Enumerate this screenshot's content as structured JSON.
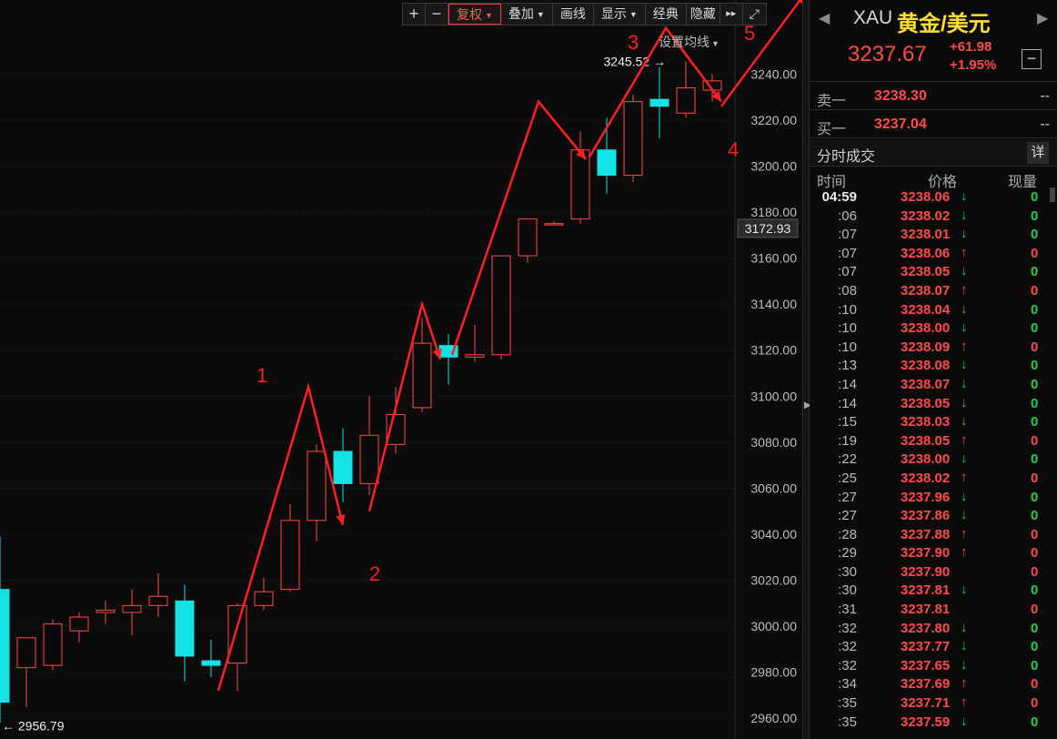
{
  "toolbar": {
    "zoom_in": "+",
    "zoom_out": "−",
    "items": [
      {
        "label": "复权",
        "dropdown": true,
        "active": true
      },
      {
        "label": "叠加",
        "dropdown": true,
        "active": false
      },
      {
        "label": "画线",
        "dropdown": false,
        "active": false
      },
      {
        "label": "显示",
        "dropdown": true,
        "active": false
      },
      {
        "label": "经典",
        "dropdown": false,
        "active": false
      },
      {
        "label": "隐藏",
        "dropdown": false,
        "active": false
      }
    ],
    "more": "▸▸",
    "fullscreen": "⤢"
  },
  "ma_setting": "设置均线",
  "chart_data": {
    "type": "candlestick",
    "y_ticks": [
      "3240.00",
      "3220.00",
      "3200.00",
      "3180.00",
      "3160.00",
      "3140.00",
      "3120.00",
      "3100.00",
      "3080.00",
      "3060.00",
      "3040.00",
      "3020.00",
      "3000.00",
      "2980.00",
      "2960.00"
    ],
    "ylim": [
      2951,
      3269
    ],
    "current_price_label": "3172.93",
    "current_price": 3172.93,
    "high_annotation": "3245.52",
    "high_value": 3245.52,
    "low_annotation": "2956.79",
    "low_value": 2956.79,
    "candles": [
      {
        "o": 2967,
        "h": 3039,
        "l": 2958,
        "c": 3016,
        "up": false
      },
      {
        "o": 2982,
        "h": 2987,
        "l": 2965,
        "c": 2995,
        "up": true
      },
      {
        "o": 2983,
        "h": 3003,
        "l": 2981,
        "c": 3001,
        "up": true
      },
      {
        "o": 2998,
        "h": 3006,
        "l": 2993,
        "c": 3004,
        "up": true
      },
      {
        "o": 3006,
        "h": 3011,
        "l": 3001,
        "c": 3007,
        "up": true
      },
      {
        "o": 3006,
        "h": 3016,
        "l": 2996,
        "c": 3009,
        "up": true
      },
      {
        "o": 3009,
        "h": 3023,
        "l": 3004,
        "c": 3013,
        "up": true
      },
      {
        "o": 3011,
        "h": 3018,
        "l": 2976,
        "c": 2987,
        "up": false
      },
      {
        "o": 2985,
        "h": 2994,
        "l": 2978,
        "c": 2983,
        "up": false
      },
      {
        "o": 2984,
        "h": 3010,
        "l": 2972,
        "c": 3009,
        "up": true
      },
      {
        "o": 3009,
        "h": 3021,
        "l": 3007,
        "c": 3015,
        "up": true
      },
      {
        "o": 3016,
        "h": 3053,
        "l": 3015,
        "c": 3046,
        "up": true
      },
      {
        "o": 3046,
        "h": 3079,
        "l": 3037,
        "c": 3076,
        "up": true
      },
      {
        "o": 3076,
        "h": 3086,
        "l": 3054,
        "c": 3062,
        "up": false
      },
      {
        "o": 3062,
        "h": 3100,
        "l": 3057,
        "c": 3083,
        "up": true
      },
      {
        "o": 3079,
        "h": 3104,
        "l": 3075,
        "c": 3092,
        "up": true
      },
      {
        "o": 3095,
        "h": 3134,
        "l": 3093,
        "c": 3123,
        "up": true
      },
      {
        "o": 3122,
        "h": 3127,
        "l": 3105,
        "c": 3117,
        "up": false
      },
      {
        "o": 3117,
        "h": 3131,
        "l": 3115,
        "c": 3118,
        "up": true
      },
      {
        "o": 3118,
        "h": 3137,
        "l": 3116,
        "c": 3161,
        "up": true
      },
      {
        "o": 3161,
        "h": 3176,
        "l": 3158,
        "c": 3177,
        "up": true
      },
      {
        "o": 3175,
        "h": 3176,
        "l": 3175,
        "c": 3175,
        "up": true
      },
      {
        "o": 3177,
        "h": 3215,
        "l": 3175,
        "c": 3207,
        "up": true
      },
      {
        "o": 3207,
        "h": 3221,
        "l": 3188,
        "c": 3196,
        "up": false
      },
      {
        "o": 3196,
        "h": 3231,
        "l": 3193,
        "c": 3228,
        "up": true
      },
      {
        "o": 3229,
        "h": 3243,
        "l": 3212,
        "c": 3226,
        "up": false
      },
      {
        "o": 3223,
        "h": 3245.52,
        "l": 3221,
        "c": 3234,
        "up": true
      },
      {
        "o": 3233,
        "h": 3240,
        "l": 3228,
        "c": 3237,
        "up": true
      }
    ],
    "wave_labels": [
      "1",
      "2",
      "3",
      "4",
      "5"
    ]
  },
  "panel": {
    "symbol_code": "XAU",
    "symbol_name": "黄金/美元",
    "price": "3237.67",
    "change": "+61.98",
    "change_pct": "+1.95%",
    "collapse_btn": "−",
    "nav_prev": "◀",
    "nav_next": "▶",
    "ask_label": "卖一",
    "ask_price": "3238.30",
    "ask_vol": "--",
    "bid_label": "买一",
    "bid_price": "3237.04",
    "bid_vol": "--",
    "ticks_title": "分时成交",
    "detail_btn": "详",
    "col_time": "时间",
    "col_price": "价格",
    "col_volume": "现量",
    "ticks": [
      {
        "t": "04:59",
        "p": "3238.06",
        "d": "down",
        "v": "0"
      },
      {
        "t": ":06",
        "p": "3238.02",
        "d": "down",
        "v": "0"
      },
      {
        "t": ":07",
        "p": "3238.01",
        "d": "down",
        "v": "0"
      },
      {
        "t": ":07",
        "p": "3238.06",
        "d": "up",
        "v": "0"
      },
      {
        "t": ":07",
        "p": "3238.05",
        "d": "down",
        "v": "0"
      },
      {
        "t": ":08",
        "p": "3238.07",
        "d": "up",
        "v": "0"
      },
      {
        "t": ":10",
        "p": "3238.04",
        "d": "down",
        "v": "0"
      },
      {
        "t": ":10",
        "p": "3238.00",
        "d": "down",
        "v": "0"
      },
      {
        "t": ":10",
        "p": "3238.09",
        "d": "up",
        "v": "0"
      },
      {
        "t": ":13",
        "p": "3238.08",
        "d": "down",
        "v": "0"
      },
      {
        "t": ":14",
        "p": "3238.07",
        "d": "down",
        "v": "0"
      },
      {
        "t": ":14",
        "p": "3238.05",
        "d": "down",
        "v": "0"
      },
      {
        "t": ":15",
        "p": "3238.03",
        "d": "down",
        "v": "0"
      },
      {
        "t": ":19",
        "p": "3238.05",
        "d": "up",
        "v": "0"
      },
      {
        "t": ":22",
        "p": "3238.00",
        "d": "down",
        "v": "0"
      },
      {
        "t": ":25",
        "p": "3238.02",
        "d": "up",
        "v": "0"
      },
      {
        "t": ":27",
        "p": "3237.96",
        "d": "down",
        "v": "0"
      },
      {
        "t": ":27",
        "p": "3237.86",
        "d": "down",
        "v": "0"
      },
      {
        "t": ":28",
        "p": "3237.88",
        "d": "up",
        "v": "0"
      },
      {
        "t": ":29",
        "p": "3237.90",
        "d": "up",
        "v": "0"
      },
      {
        "t": ":30",
        "p": "3237.90",
        "d": "",
        "v": "0"
      },
      {
        "t": ":30",
        "p": "3237.81",
        "d": "down",
        "v": "0"
      },
      {
        "t": ":31",
        "p": "3237.81",
        "d": "",
        "v": "0"
      },
      {
        "t": ":32",
        "p": "3237.80",
        "d": "down",
        "v": "0"
      },
      {
        "t": ":32",
        "p": "3237.77",
        "d": "down",
        "v": "0"
      },
      {
        "t": ":32",
        "p": "3237.65",
        "d": "down",
        "v": "0"
      },
      {
        "t": ":34",
        "p": "3237.69",
        "d": "up",
        "v": "0"
      },
      {
        "t": ":35",
        "p": "3237.71",
        "d": "up",
        "v": "0"
      },
      {
        "t": ":35",
        "p": "3237.59",
        "d": "down",
        "v": "0"
      }
    ]
  }
}
